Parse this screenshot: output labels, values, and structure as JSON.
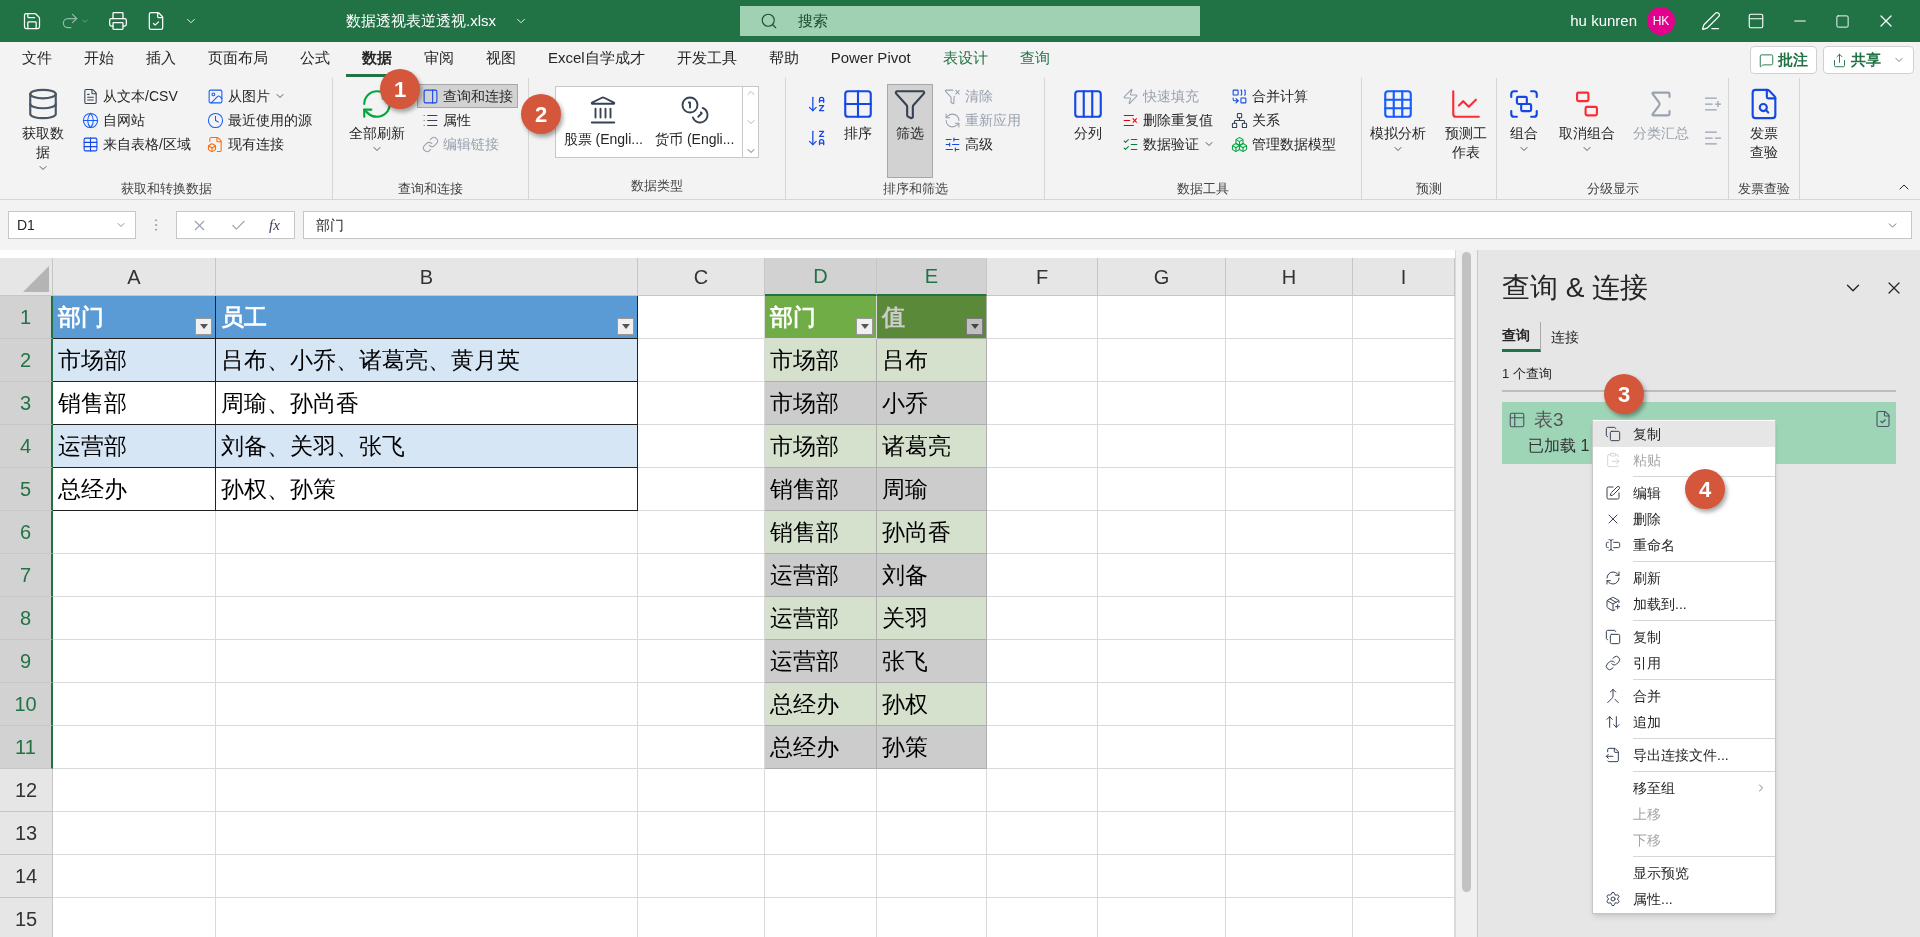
{
  "title_bar": {
    "file_name": "数据透视表逆透视.xlsx",
    "search_placeholder": "搜索",
    "user": "hu kunren",
    "avatar": "HK"
  },
  "menu_tabs": [
    {
      "label": "文件",
      "selected": false,
      "kind": "normal"
    },
    {
      "label": "开始",
      "selected": false,
      "kind": "normal"
    },
    {
      "label": "插入",
      "selected": false,
      "kind": "normal"
    },
    {
      "label": "页面布局",
      "selected": false,
      "kind": "normal"
    },
    {
      "label": "公式",
      "selected": false,
      "kind": "normal"
    },
    {
      "label": "数据",
      "selected": true,
      "kind": "normal"
    },
    {
      "label": "审阅",
      "selected": false,
      "kind": "normal"
    },
    {
      "label": "视图",
      "selected": false,
      "kind": "normal"
    },
    {
      "label": "Excel自学成才",
      "selected": false,
      "kind": "normal"
    },
    {
      "label": "开发工具",
      "selected": false,
      "kind": "normal"
    },
    {
      "label": "帮助",
      "selected": false,
      "kind": "normal"
    },
    {
      "label": "Power Pivot",
      "selected": false,
      "kind": "normal"
    },
    {
      "label": "表设计",
      "selected": false,
      "kind": "contextual"
    },
    {
      "label": "查询",
      "selected": false,
      "kind": "contextual"
    }
  ],
  "actions": [
    {
      "label": "批注",
      "kind": "comment"
    },
    {
      "label": "共享",
      "kind": "share"
    }
  ],
  "ribbon": [
    {
      "label": "获取和转换数据",
      "columns": [
        {
          "kind": "large",
          "label": "获取数据",
          "disabled": false,
          "selected": false,
          "menu": true
        },
        {
          "kind": "stack",
          "items": [
            {
              "label": "从文本/CSV",
              "disabled": false,
              "selected": false,
              "menu": false
            },
            {
              "label": "自网站",
              "disabled": false,
              "selected": false,
              "menu": false
            },
            {
              "label": "来自表格/区域",
              "disabled": false,
              "selected": false,
              "menu": false
            }
          ]
        },
        {
          "kind": "stack",
          "items": [
            {
              "label": "从图片",
              "disabled": false,
              "selected": false,
              "menu": true
            },
            {
              "label": "最近使用的源",
              "disabled": false,
              "selected": false,
              "menu": false
            },
            {
              "label": "现有连接",
              "disabled": false,
              "selected": false,
              "menu": false
            }
          ]
        }
      ]
    },
    {
      "label": "查询和连接",
      "columns": [
        {
          "kind": "large",
          "label": "全部刷新",
          "disabled": false,
          "selected": false,
          "menu": true
        },
        {
          "kind": "stack",
          "items": [
            {
              "label": "查询和连接",
              "disabled": false,
              "selected": true,
              "menu": false
            },
            {
              "label": "属性",
              "disabled": false,
              "selected": false,
              "menu": false
            },
            {
              "label": "编辑链接",
              "disabled": true,
              "selected": false,
              "menu": false
            }
          ]
        }
      ]
    },
    {
      "label": "数据类型",
      "columns": [
        {
          "kind": "gallery",
          "items": [
            {
              "label": "股票 (Engli..."
            },
            {
              "label": "货币 (Engli..."
            }
          ]
        }
      ]
    },
    {
      "label": "排序和筛选",
      "columns": [
        {
          "kind": "icon-buttons"
        },
        {
          "kind": "large",
          "label": "排序",
          "disabled": false,
          "selected": false,
          "menu": false
        },
        {
          "kind": "large",
          "label": "筛选",
          "disabled": false,
          "selected": true,
          "menu": false
        },
        {
          "kind": "stack",
          "items": [
            {
              "label": "清除",
              "disabled": true,
              "selected": false,
              "menu": false
            },
            {
              "label": "重新应用",
              "disabled": true,
              "selected": false,
              "menu": false
            },
            {
              "label": "高级",
              "disabled": false,
              "selected": false,
              "menu": false
            }
          ]
        }
      ]
    },
    {
      "label": "数据工具",
      "columns": [
        {
          "kind": "large",
          "label": "分列",
          "disabled": false,
          "selected": false,
          "menu": false
        },
        {
          "kind": "stack",
          "items": [
            {
              "label": "快速填充",
              "disabled": true,
              "selected": false,
              "menu": false
            },
            {
              "label": "删除重复值",
              "disabled": false,
              "selected": false,
              "menu": false
            },
            {
              "label": "数据验证",
              "disabled": false,
              "selected": false,
              "menu": true
            }
          ]
        },
        {
          "kind": "stack",
          "items": [
            {
              "label": "合并计算",
              "disabled": false,
              "selected": false,
              "menu": false
            },
            {
              "label": "关系",
              "disabled": false,
              "selected": false,
              "menu": false
            },
            {
              "label": "管理数据模型",
              "disabled": false,
              "selected": false,
              "menu": false
            }
          ]
        }
      ]
    },
    {
      "label": "预测",
      "columns": [
        {
          "kind": "large",
          "label": "模拟分析",
          "disabled": false,
          "selected": false,
          "menu": true
        },
        {
          "kind": "large",
          "label": "预测工作表",
          "disabled": false,
          "selected": false,
          "menu": false
        }
      ]
    },
    {
      "label": "分级显示",
      "columns": [
        {
          "kind": "large",
          "label": "组合",
          "disabled": false,
          "selected": false,
          "menu": true
        },
        {
          "kind": "large",
          "label": "取消组合",
          "disabled": false,
          "selected": false,
          "menu": true
        },
        {
          "kind": "large",
          "label": "分类汇总",
          "disabled": true,
          "selected": false,
          "menu": false
        },
        {
          "kind": "icon-buttons"
        }
      ]
    },
    {
      "label": "发票查验",
      "columns": [
        {
          "kind": "large",
          "label": "发票查验",
          "disabled": false,
          "selected": false,
          "menu": false
        }
      ]
    }
  ],
  "formula_bar": {
    "name_box": "D1",
    "fx": "fx",
    "formula": "部门"
  },
  "sheet": {
    "columns": [
      {
        "label": "A",
        "selected": false
      },
      {
        "label": "B",
        "selected": false
      },
      {
        "label": "C",
        "selected": false
      },
      {
        "label": "D",
        "selected": true
      },
      {
        "label": "E",
        "selected": true
      },
      {
        "label": "F",
        "selected": false
      },
      {
        "label": "G",
        "selected": false
      },
      {
        "label": "H",
        "selected": false
      },
      {
        "label": "I",
        "selected": false
      }
    ],
    "rows": [
      {
        "label": "1",
        "selected": true
      },
      {
        "label": "2",
        "selected": true
      },
      {
        "label": "3",
        "selected": true
      },
      {
        "label": "4",
        "selected": true
      },
      {
        "label": "5",
        "selected": true
      },
      {
        "label": "6",
        "selected": true
      },
      {
        "label": "7",
        "selected": true
      },
      {
        "label": "8",
        "selected": true
      },
      {
        "label": "9",
        "selected": true
      },
      {
        "label": "10",
        "selected": true
      },
      {
        "label": "11",
        "selected": true
      },
      {
        "label": "12",
        "selected": false
      },
      {
        "label": "13",
        "selected": false
      },
      {
        "label": "14",
        "selected": false
      },
      {
        "label": "15",
        "selected": false
      }
    ],
    "tables": [
      {
        "color": "#5b9bd5",
        "borders": true,
        "headers": [
          "部门",
          "员工"
        ],
        "rows": [
          [
            "市场部",
            "吕布、小乔、诸葛亮、黄月英"
          ],
          [
            "销售部",
            "周瑜、孙尚香"
          ],
          [
            "运营部",
            "刘备、关羽、张飞"
          ],
          [
            "总经办",
            "孙权、孙策"
          ]
        ]
      },
      {
        "color": "#70ad47",
        "borders": false,
        "headers": [
          "部门",
          "值"
        ],
        "rows": [
          [
            "市场部",
            "吕布"
          ],
          [
            "市场部",
            "小乔"
          ],
          [
            "市场部",
            "诸葛亮"
          ],
          [
            "销售部",
            "周瑜"
          ],
          [
            "销售部",
            "孙尚香"
          ],
          [
            "运营部",
            "刘备"
          ],
          [
            "运营部",
            "关羽"
          ],
          [
            "运营部",
            "张飞"
          ],
          [
            "总经办",
            "孙权"
          ],
          [
            "总经办",
            "孙策"
          ]
        ]
      }
    ]
  },
  "panel": {
    "title": "查询 & 连接",
    "tabs": [
      {
        "label": "查询",
        "selected": true
      },
      {
        "label": "连接",
        "selected": false
      }
    ],
    "count": "1 个查询",
    "queries": [
      {
        "name": "表3",
        "status": "已加载 1",
        "selected": true
      }
    ]
  },
  "context_menu": [
    {
      "kind": "item",
      "label": "复制",
      "disabled": false,
      "hovered": true
    },
    {
      "kind": "item",
      "label": "粘贴",
      "disabled": true,
      "hovered": false
    },
    {
      "kind": "separator"
    },
    {
      "kind": "item",
      "label": "编辑",
      "disabled": false,
      "hovered": false
    },
    {
      "kind": "item",
      "label": "删除",
      "disabled": false,
      "hovered": false
    },
    {
      "kind": "item",
      "label": "重命名",
      "disabled": false,
      "hovered": false
    },
    {
      "kind": "separator"
    },
    {
      "kind": "item",
      "label": "刷新",
      "disabled": false,
      "hovered": false
    },
    {
      "kind": "item",
      "label": "加载到...",
      "disabled": false,
      "hovered": false
    },
    {
      "kind": "separator"
    },
    {
      "kind": "item",
      "label": "复制",
      "disabled": false,
      "hovered": false
    },
    {
      "kind": "item",
      "label": "引用",
      "disabled": false,
      "hovered": false
    },
    {
      "kind": "separator"
    },
    {
      "kind": "item",
      "label": "合并",
      "disabled": false,
      "hovered": false
    },
    {
      "kind": "item",
      "label": "追加",
      "disabled": false,
      "hovered": false
    },
    {
      "kind": "separator"
    },
    {
      "kind": "item",
      "label": "导出连接文件...",
      "disabled": false,
      "hovered": false
    },
    {
      "kind": "separator"
    },
    {
      "kind": "submenu",
      "label": "移至组",
      "disabled": false,
      "hovered": false
    },
    {
      "kind": "item",
      "label": "上移",
      "disabled": true,
      "hovered": false
    },
    {
      "kind": "item",
      "label": "下移",
      "disabled": true,
      "hovered": false
    },
    {
      "kind": "separator"
    },
    {
      "kind": "item",
      "label": "显示预览",
      "disabled": false,
      "hovered": false
    },
    {
      "kind": "item",
      "label": "属性...",
      "disabled": false,
      "hovered": false
    }
  ],
  "callouts": [
    "1",
    "2",
    "3",
    "4"
  ]
}
